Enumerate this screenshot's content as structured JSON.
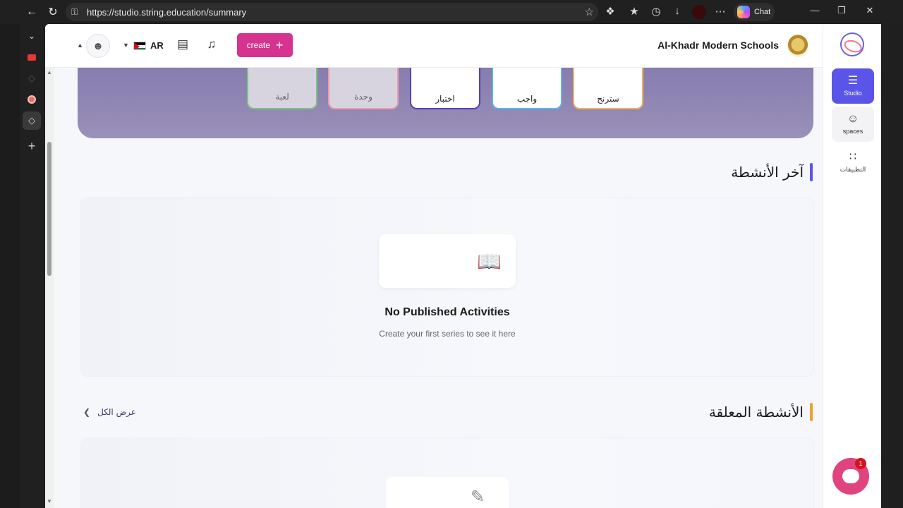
{
  "browser": {
    "url": "https://studio.string.education/summary",
    "chat_label": "Chat"
  },
  "header": {
    "language": "AR",
    "create_label": "create",
    "school_name": "Al-Khadr Modern Schools"
  },
  "sidebar": {
    "items": [
      {
        "label": "Studio",
        "icon": "layers-icon",
        "active": true
      },
      {
        "label": "spaces",
        "icon": "chat-face-icon",
        "active": false
      },
      {
        "label": "التطبيقات",
        "icon": "apps-grid-icon",
        "active": false
      }
    ]
  },
  "categories": [
    {
      "label": "لعبة",
      "icon": "game-controller-icon",
      "border": "#7bc47f"
    },
    {
      "label": "وحدة",
      "icon": "unit-icon",
      "border": "#f09aa6"
    },
    {
      "label": "اختبار",
      "icon": "quiz-icon",
      "border": "#5a3fb8"
    },
    {
      "label": "واجب",
      "icon": "homework-icon",
      "border": "#5bb5e8"
    },
    {
      "label": "سترنج",
      "icon": "book-icon",
      "border": "#f0b35a"
    }
  ],
  "recent": {
    "title": "آخر الأنشطة",
    "accent": "#5b54e8",
    "empty_title": "No Published Activities",
    "empty_subtitle": "Create your first series to see it here"
  },
  "pending": {
    "title": "الأنشطة المعلقة",
    "accent": "#f0a030",
    "view_all": "عرض الكل"
  },
  "chat_widget": {
    "badge": "1"
  }
}
